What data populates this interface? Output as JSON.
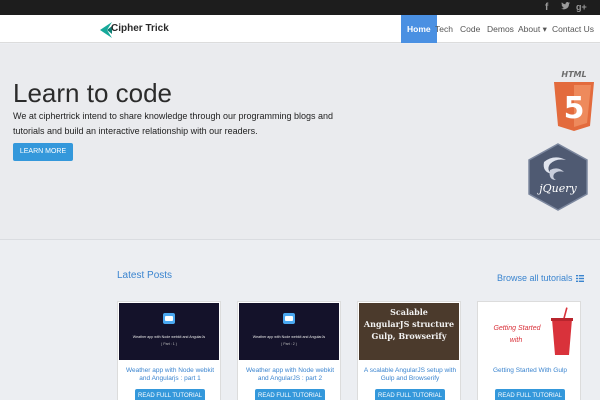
{
  "social": {
    "facebook": "f",
    "twitter": "🐦",
    "googleplus": "g+"
  },
  "brand": {
    "name": "Cipher Trick",
    "accent": "#16a99a"
  },
  "nav": {
    "home": "Home",
    "tech": "Tech",
    "code": "Code",
    "demos": "Demos",
    "about": "About ▾",
    "contact": "Contact Us"
  },
  "hero": {
    "title": "Learn to code",
    "text": "We at ciphertrick intend to share knowledge through our programming blogs and tutorials and build an interactive relationship with our readers.",
    "button": "LEARN MORE",
    "html5_label": "HTML",
    "jquery_label": "jQuery"
  },
  "posts": {
    "title": "Latest Posts",
    "browse": "Browse all tutorials",
    "button_label": "READ FULL TUTORIAL",
    "items": [
      {
        "title": "Weather app with Node webkit and Angularjs : part 1",
        "thumb_caption": "Weather app with Node webkit and AngularJs",
        "thumb_sub": "( Part : 1 )"
      },
      {
        "title": "Weather app with Node webkit and AngularJS : part 2",
        "thumb_caption": "Weather app with Node webkit and AngularJs",
        "thumb_sub": "( Part : 2 )"
      },
      {
        "title": "A scalable AngularJS setup with Gulp and Browserify",
        "thumb_lines": [
          "Scalable",
          "AngularJS structure",
          "Gulp, Browserify"
        ]
      },
      {
        "title": "Getting Started With Gulp",
        "thumb_lines": [
          "Getting Started",
          "with"
        ]
      }
    ]
  },
  "colors": {
    "primary": "#3498db",
    "link": "#3a84cf",
    "nav_active": "#4a90e2"
  }
}
